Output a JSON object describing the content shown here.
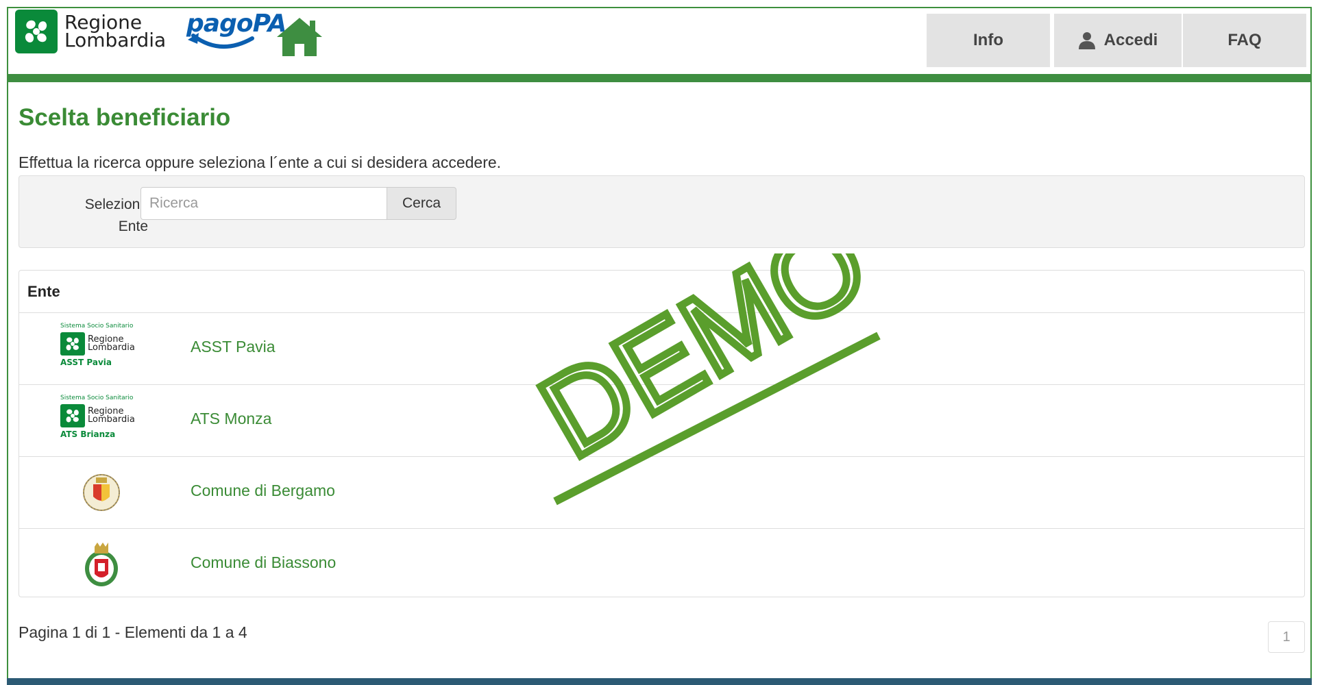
{
  "header": {
    "logo_text_line1": "Regione",
    "logo_text_line2": "Lombardia",
    "pagopa_text": "pagoPA",
    "nav": {
      "info": "Info",
      "accedi": "Accedi",
      "faq": "FAQ"
    }
  },
  "page": {
    "title": "Scelta beneficiario",
    "intro": "Effettua la ricerca oppure seleziona l´ente a cui si desidera accedere."
  },
  "search": {
    "label_line1": "Selezione",
    "label_line2": "Ente",
    "placeholder": "Ricerca",
    "button": "Cerca"
  },
  "table": {
    "header": "Ente",
    "rows": [
      {
        "name": "ASST Pavia",
        "logo_top": "Sistema Socio Sanitario",
        "logo_l1": "Regione",
        "logo_l2": "Lombardia",
        "logo_bottom": "ASST Pavia"
      },
      {
        "name": "ATS Monza",
        "logo_top": "Sistema Socio Sanitario",
        "logo_l1": "Regione",
        "logo_l2": "Lombardia",
        "logo_bottom": "ATS Brianza"
      },
      {
        "name": "Comune di Bergamo"
      },
      {
        "name": "Comune di Biassono"
      }
    ]
  },
  "pagination": {
    "summary": "Pagina 1 di 1 - Elementi da 1 a 4",
    "current_page": "1"
  },
  "watermark": "DEMO",
  "colors": {
    "brand_green": "#3a8b35",
    "header_bar": "#3e8e41",
    "logo_green": "#0a8a3a",
    "pagopa_blue": "#0b5fb0",
    "watermark_green": "#5a9e2c"
  }
}
